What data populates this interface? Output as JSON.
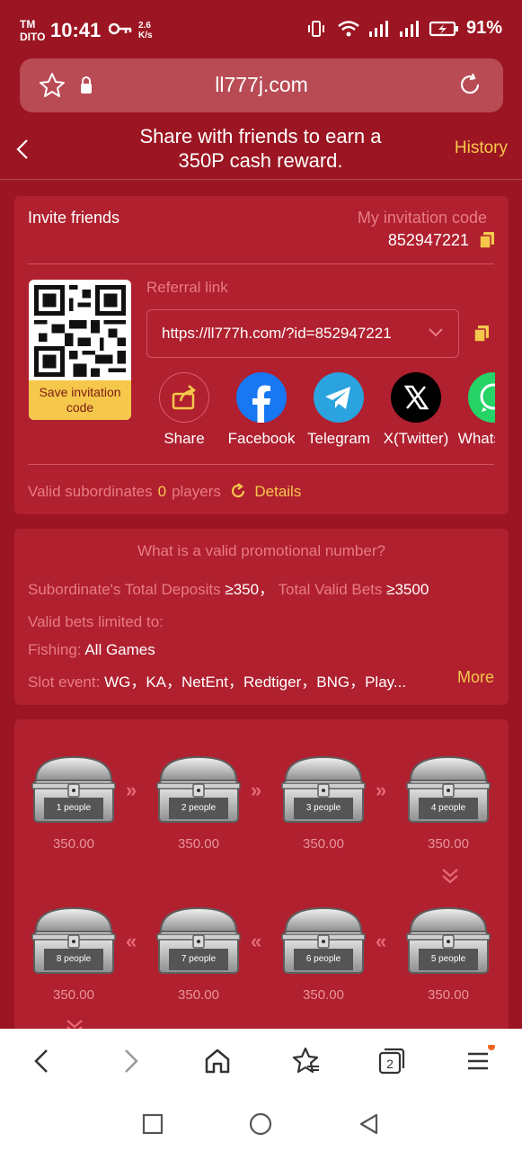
{
  "status_bar": {
    "carrier_top": "TM",
    "carrier_bottom": "DITO",
    "time": "10:41",
    "speed_top": "2.6",
    "speed_bottom": "K/s",
    "battery": "91%"
  },
  "browser": {
    "url": "ll777j.com"
  },
  "header": {
    "title_line1": "Share with friends to earn a",
    "title_line2": "350P cash reward.",
    "history_label": "History"
  },
  "invite": {
    "title": "Invite friends",
    "my_code_label": "My invitation code",
    "my_code": "852947221",
    "save_code_label_1": "Save invitation",
    "save_code_label_2": "code",
    "referral_label": "Referral link",
    "referral_link": "https://ll777h.com/?id=852947221",
    "share_targets": [
      {
        "label": "Share",
        "icon": "share-icon"
      },
      {
        "label": "Facebook",
        "icon": "facebook-icon"
      },
      {
        "label": "Telegram",
        "icon": "telegram-icon"
      },
      {
        "label": "X(Twitter)",
        "icon": "x-twitter-icon"
      },
      {
        "label": "WhatsApp",
        "icon": "whatsapp-icon"
      }
    ],
    "valid_label": "Valid subordinates",
    "valid_count": "0",
    "valid_unit": "players",
    "details_label": "Details"
  },
  "promo": {
    "title": "What is a valid promotional number?",
    "deposits_label": "Subordinate's Total Deposits",
    "deposits_value": "≥350",
    "bets_label": "Total Valid Bets",
    "bets_value": "≥3500",
    "limited_label": "Valid bets limited to:",
    "fishing_label": "Fishing:",
    "fishing_value": "All Games",
    "slot_label": "Slot event:",
    "slot_value": "WG，KA，NetEnt，Redtiger，BNG，Play...",
    "more_label": "More"
  },
  "chests": [
    {
      "label": "1 people",
      "amount": "350.00"
    },
    {
      "label": "2 people",
      "amount": "350.00"
    },
    {
      "label": "3 people",
      "amount": "350.00"
    },
    {
      "label": "4 people",
      "amount": "350.00"
    },
    {
      "label": "5 people",
      "amount": "350.00"
    },
    {
      "label": "6 people",
      "amount": "350.00"
    },
    {
      "label": "7 people",
      "amount": "350.00"
    },
    {
      "label": "8 people",
      "amount": "350.00"
    }
  ],
  "bottom_nav": {
    "tabs_count": "2"
  },
  "colors": {
    "background": "#9c1522",
    "card": "#b0202f",
    "accent_gold": "#f5c84c",
    "muted_pink": "#e97b84"
  }
}
